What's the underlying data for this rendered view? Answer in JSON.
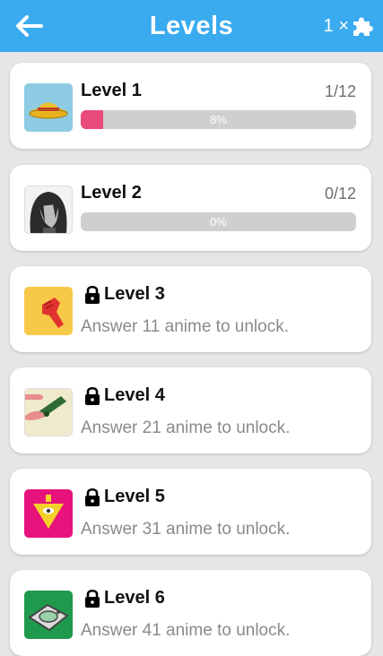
{
  "header": {
    "title": "Levels",
    "hint_count": "1 ×"
  },
  "levels": [
    {
      "name": "Level 1",
      "progress": "1/12",
      "percent_label": "8%",
      "percent": 8
    },
    {
      "name": "Level 2",
      "progress": "0/12",
      "percent_label": "0%",
      "percent": 0
    },
    {
      "name": "Level 3",
      "unlock_text": "Answer 11 anime to unlock."
    },
    {
      "name": "Level 4",
      "unlock_text": "Answer 21 anime to unlock."
    },
    {
      "name": "Level 5",
      "unlock_text": "Answer 31 anime to unlock."
    },
    {
      "name": "Level 6",
      "unlock_text": "Answer 41 anime to unlock."
    }
  ],
  "colors": {
    "header": "#3aabef",
    "progress_fill": "#e94a7c",
    "progress_track": "#cfcfcf",
    "background": "#e6e6e6"
  },
  "icons": {
    "back": "arrow-left-icon",
    "hint": "puzzle-piece-icon",
    "lock": "lock-icon"
  }
}
